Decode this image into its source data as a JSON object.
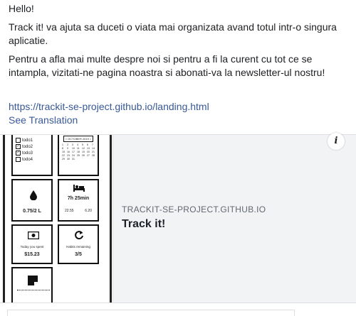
{
  "post": {
    "greeting": "Hello!",
    "paragraph1": "Track it! va ajuta sa duceti o viata mai organizata avand totul intr-o singura aplicatie.",
    "paragraph2": "Pentru a afla mai multe despre noi si pentru a fi la curent cu tot ce se intampla, vizitati-ne pagina noastra si abonati-va la newsletter-ul nostru!",
    "link": "https://trackit-se-project.github.io/landing.html",
    "see_translation": "See Translation"
  },
  "card": {
    "domain": "TRACKIT-SE-PROJECT.GITHUB.IO",
    "title": "Track it!",
    "info_glyph": "i"
  },
  "thumbnail": {
    "todos": [
      "todo1",
      "todo2",
      "todo3",
      "todo4"
    ],
    "todo_checked": [
      true,
      true,
      true,
      false
    ],
    "calendar_month": "< OCTOBER 2019 >",
    "calendar_days": [
      "1",
      "2",
      "3",
      "4",
      "5",
      "6",
      "7",
      "8",
      "9",
      "10",
      "11",
      "12",
      "13",
      "14",
      "15",
      "16",
      "17",
      "18",
      "19",
      "20",
      "21",
      "22",
      "23",
      "24",
      "25",
      "26",
      "27",
      "28",
      "29",
      "30",
      "31"
    ],
    "water_value": "0.75/2 L",
    "sleep_value": "7h 25min",
    "sleep_start": "22.55",
    "sleep_end": "6.20",
    "spent_label": "Today you spent",
    "spent_value": "$15.23",
    "habits_label": "Habits remaining",
    "habits_value": "3/5"
  }
}
